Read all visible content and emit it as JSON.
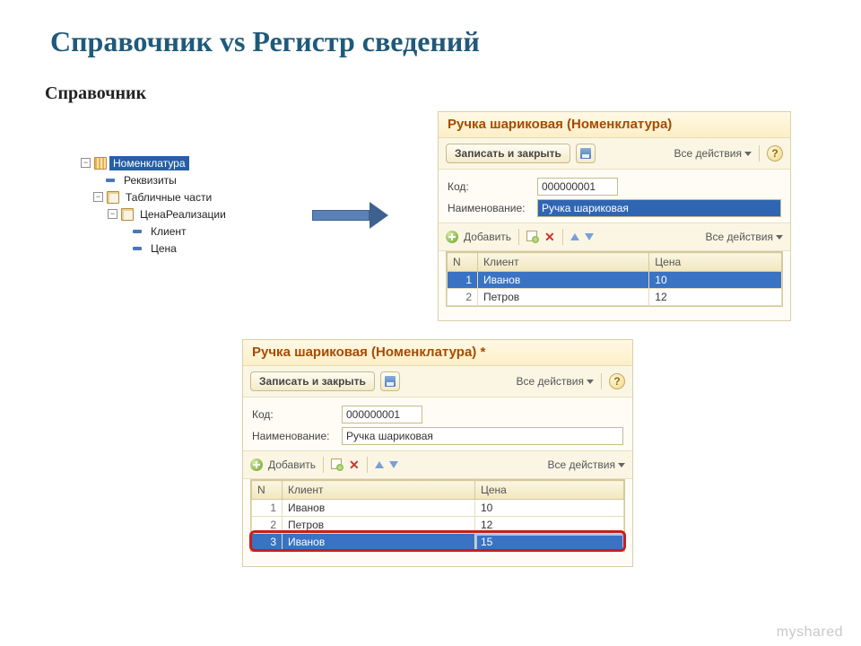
{
  "slide": {
    "title": "Справочник vs Регистр сведений",
    "subtitle": "Справочник",
    "watermark": "myshared"
  },
  "tree": {
    "root": "Номенклатура",
    "attrs": "Реквизиты",
    "tabular": "Табличные части",
    "tab1": "ЦенаРеализации",
    "f1": "Клиент",
    "f2": "Цена"
  },
  "form": {
    "title_top": "Ручка шариковая (Номенклатура)",
    "title_bottom": "Ручка шариковая (Номенклатура) *",
    "save_close": "Записать и закрыть",
    "all_actions": "Все действия",
    "add": "Добавить",
    "code_label": "Код:",
    "name_label": "Наименование:",
    "code_value": "000000001",
    "name_value": "Ручка шариковая",
    "col_n": "N",
    "col_client": "Клиент",
    "col_price": "Цена"
  },
  "rows_top": [
    {
      "n": "1",
      "client": "Иванов",
      "price": "10"
    },
    {
      "n": "2",
      "client": "Петров",
      "price": "12"
    }
  ],
  "rows_bottom": [
    {
      "n": "1",
      "client": "Иванов",
      "price": "10"
    },
    {
      "n": "2",
      "client": "Петров",
      "price": "12"
    },
    {
      "n": "3",
      "client": "Иванов",
      "price": "15"
    }
  ]
}
